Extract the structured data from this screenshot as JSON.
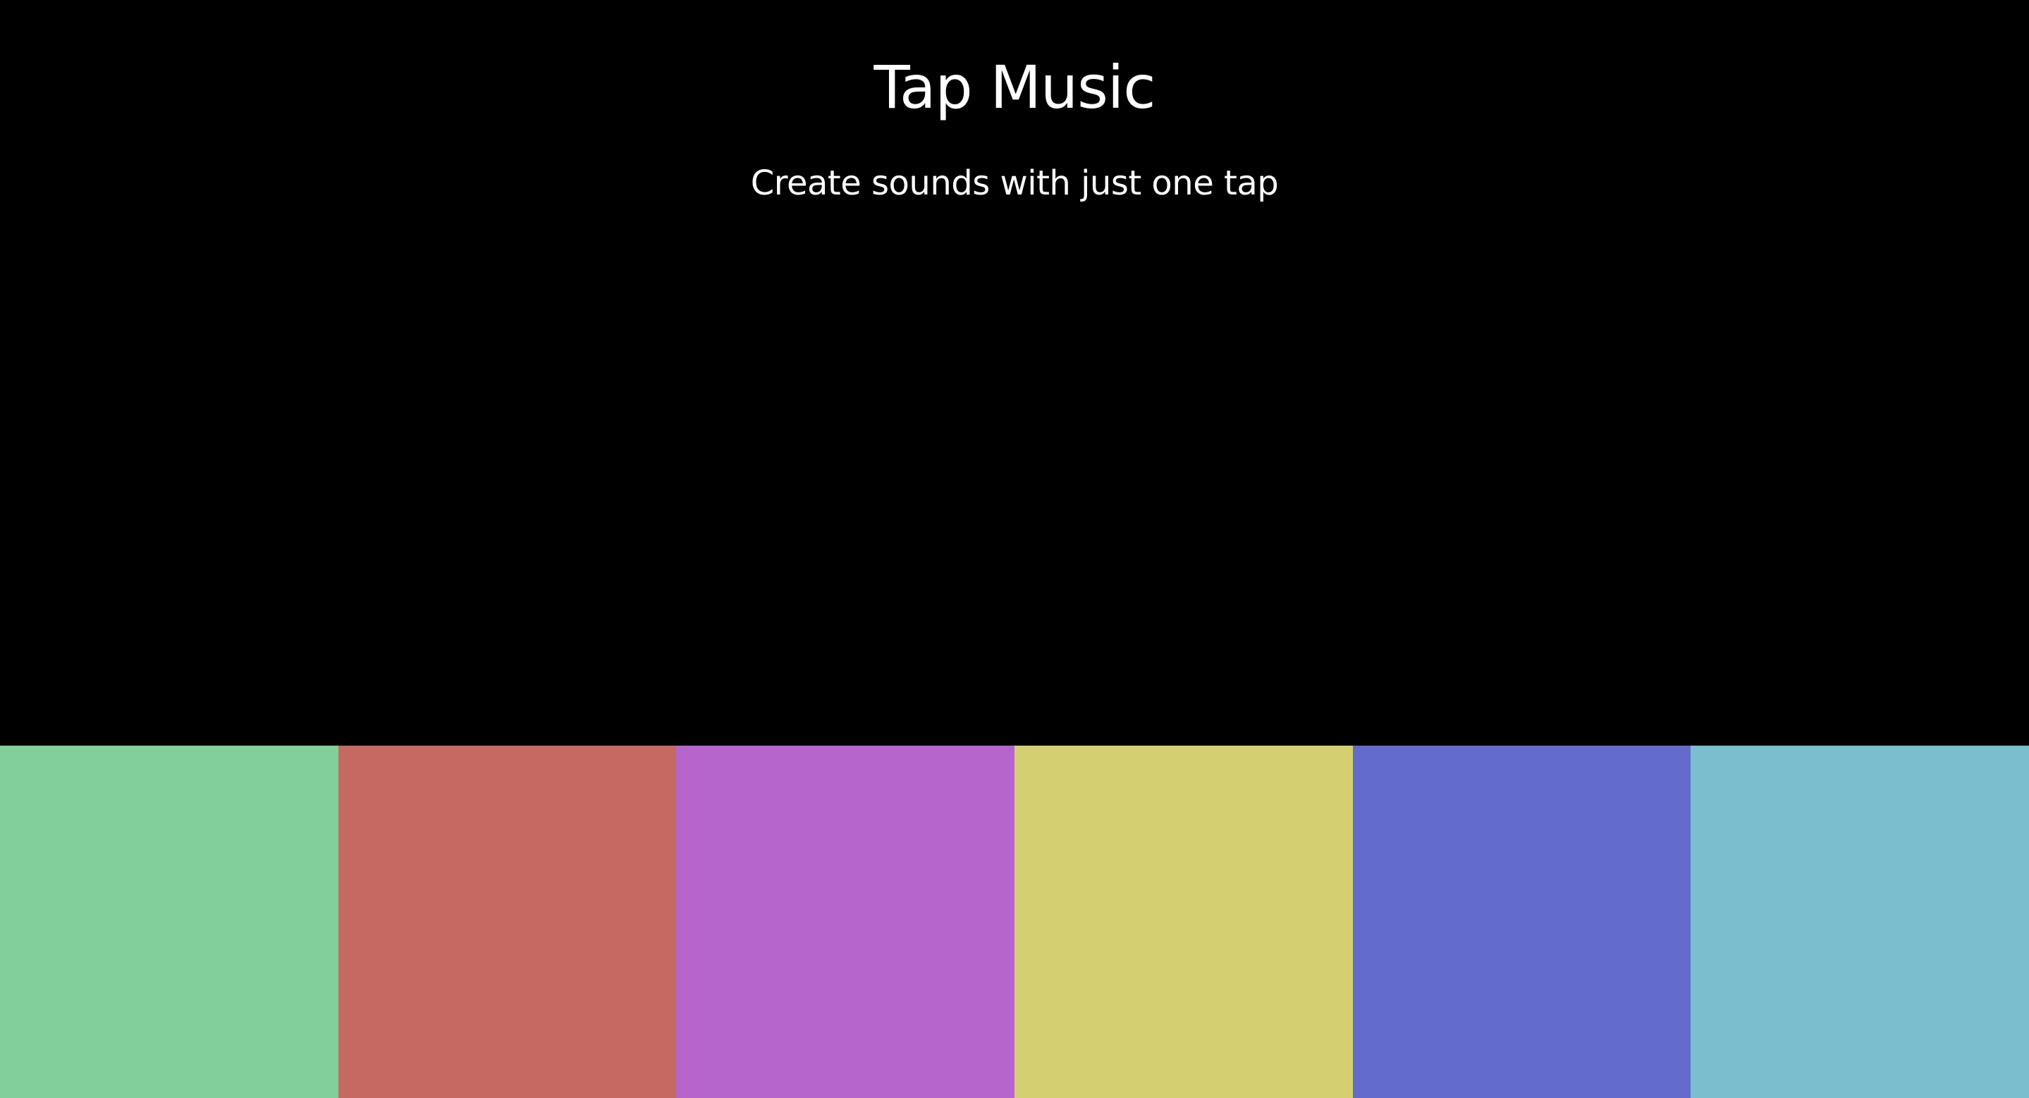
{
  "header": {
    "title": "Tap Music",
    "subtitle": "Create sounds with just one tap"
  },
  "pads": [
    {
      "id": "pad-1",
      "color": "#82cf99"
    },
    {
      "id": "pad-2",
      "color": "#c66963"
    },
    {
      "id": "pad-3",
      "color": "#b565cb"
    },
    {
      "id": "pad-4",
      "color": "#d4d072"
    },
    {
      "id": "pad-5",
      "color": "#636bcc"
    },
    {
      "id": "pad-6",
      "color": "#7bbfcf"
    }
  ]
}
